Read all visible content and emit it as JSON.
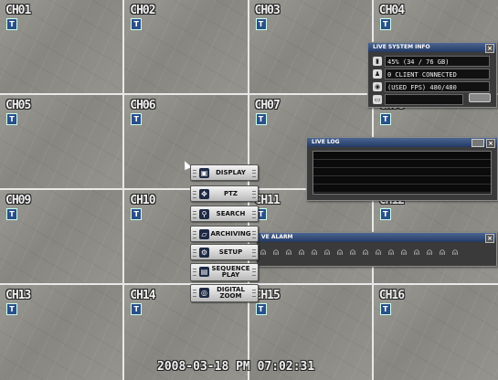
{
  "channels": [
    {
      "label": "CH01",
      "badge": "T"
    },
    {
      "label": "CH02",
      "badge": "T"
    },
    {
      "label": "CH03",
      "badge": "T"
    },
    {
      "label": "CH04",
      "badge": "T"
    },
    {
      "label": "CH05",
      "badge": "T"
    },
    {
      "label": "CH06",
      "badge": "T"
    },
    {
      "label": "CH07",
      "badge": "T"
    },
    {
      "label": "CH08",
      "badge": "T"
    },
    {
      "label": "CH09",
      "badge": "T"
    },
    {
      "label": "CH10",
      "badge": "T"
    },
    {
      "label": "CH11",
      "badge": "T"
    },
    {
      "label": "CH12",
      "badge": "T"
    },
    {
      "label": "CH13",
      "badge": "T"
    },
    {
      "label": "CH14",
      "badge": "T"
    },
    {
      "label": "CH15",
      "badge": "T"
    },
    {
      "label": "CH16",
      "badge": "T"
    }
  ],
  "system_info": {
    "title": "LIVE SYSTEM INFO",
    "close": "×",
    "rows": [
      {
        "icon": "disk-icon",
        "text": "45% (34 / 76 GB)"
      },
      {
        "icon": "client-icon",
        "text": "0 CLIENT CONNECTED"
      },
      {
        "icon": "fps-icon",
        "text": "(USED FPS) 480/480"
      },
      {
        "icon": "folder-icon",
        "text": ""
      }
    ]
  },
  "live_log": {
    "title": "LIVE LOG",
    "close": "×"
  },
  "live_alarm": {
    "title": "VE ALARM",
    "close": "×",
    "icon_count": 16
  },
  "menu": [
    {
      "name": "display",
      "label": "DISPLAY",
      "icon": "monitor-icon"
    },
    {
      "name": "ptz",
      "label": "PTZ",
      "icon": "ptz-icon"
    },
    {
      "name": "search",
      "label": "SEARCH",
      "icon": "search-icon"
    },
    {
      "name": "archiving",
      "label": "ARCHIVING",
      "icon": "folder-icon"
    },
    {
      "name": "setup",
      "label": "SETUP",
      "icon": "gear-icon"
    },
    {
      "name": "sequence-play",
      "label": "SEQUENCE PLAY",
      "icon": "sequence-icon"
    },
    {
      "name": "digital-zoom",
      "label": "DIGITAL ZOOM",
      "icon": "zoom-icon"
    }
  ],
  "datetime": "2008-03-18 PM 07:02:31",
  "colors": {
    "panel_title": "#2f4a7a",
    "panel_bg": "#3a3a3a",
    "grid_line": "#e8e8e8"
  }
}
